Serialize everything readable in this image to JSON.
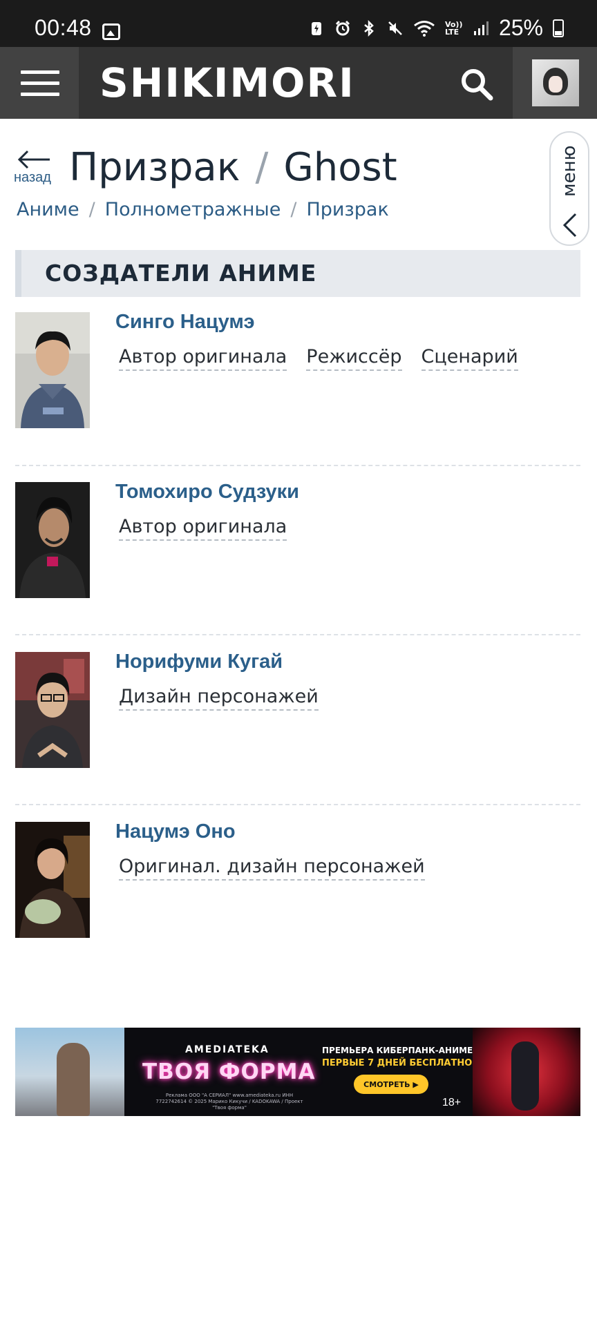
{
  "status_bar": {
    "time": "00:48",
    "battery": "25%",
    "network": "Vo)) LTE",
    "icons": [
      "image-icon",
      "battery-saver-icon",
      "alarm-icon",
      "bluetooth-icon",
      "mute-icon",
      "wifi-icon",
      "signal-icon",
      "battery-icon"
    ]
  },
  "header": {
    "logo": "SHIKIMORI",
    "menu_icon": "hamburger-icon",
    "search_icon": "search-icon"
  },
  "page": {
    "back_label": "назад",
    "title_ru": "Призрак",
    "title_sep": "/",
    "title_en": "Ghost",
    "breadcrumbs": [
      "Аниме",
      "Полнометражные",
      "Призрак"
    ],
    "breadcrumb_sep": "/",
    "side_menu_label": "меню"
  },
  "section": {
    "title": "СОЗДАТЕЛИ АНИМЕ"
  },
  "people": [
    {
      "name": "Синго Нацумэ",
      "roles": [
        "Автор оригинала",
        "Режиссёр",
        "Сценарий"
      ]
    },
    {
      "name": "Томохиро Судзуки",
      "roles": [
        "Автор оригинала"
      ]
    },
    {
      "name": "Норифуми Кугай",
      "roles": [
        "Дизайн персонажей"
      ]
    },
    {
      "name": "Нацумэ Оно",
      "roles": [
        "Оригинал. дизайн персонажей"
      ]
    }
  ],
  "banner": {
    "brand": "AMEDIATEKA",
    "title": "ТВОЯ ФОРМА",
    "premiere": "ПРЕМЬЕРА КИБЕРПАНК-АНИМЕ",
    "free": "ПЕРВЫЕ 7 ДНЕЙ БЕСПЛАТНО",
    "button": "СМОТРЕТЬ ▶",
    "age": "18+",
    "legal": "Реклама ООО \"А СЕРИАЛ\" www.amediateka.ru ИНН 7722742614 © 2025 Марико Кикучи / KADOKAWA / Проект \"Твоя форма\""
  },
  "colors": {
    "header_bg": "#333333",
    "link": "#2b5f8a",
    "section_bg": "#e7eaee",
    "statusbar_bg": "#1b1b1b"
  }
}
